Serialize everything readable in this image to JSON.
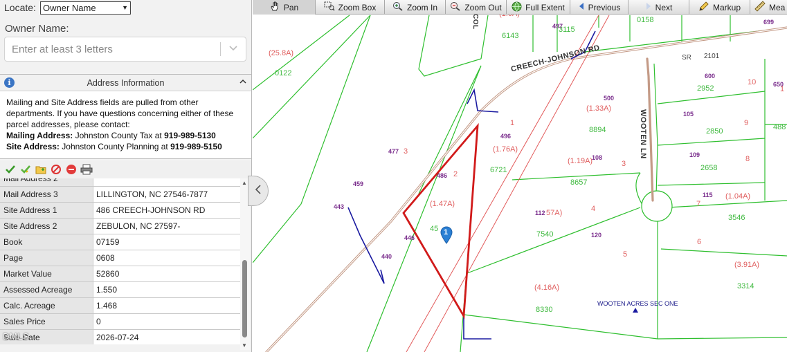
{
  "locate": {
    "label": "Locate:",
    "selected": "Owner Name"
  },
  "owner": {
    "label": "Owner Name:",
    "placeholder": "Enter at least 3 letters"
  },
  "address_panel": {
    "title": "Address Information",
    "body": "Mailing and Site Address fields are pulled from other departments. If you have questions concerning either of these parcel addresses, please contact:",
    "mailing_label": "Mailing Address:",
    "mailing_text": "Johnston County Tax at",
    "mailing_phone": "919-989-5130",
    "site_label": "Site Address:",
    "site_text": "Johnston County Planning at",
    "site_phone": "919-989-5150"
  },
  "tools": [
    "check-icon",
    "check-all-icon",
    "folder-icon",
    "cancel-icon",
    "remove-icon",
    "print-icon"
  ],
  "attributes": [
    {
      "key": "Mail Address 2",
      "value": ""
    },
    {
      "key": "Mail Address 3",
      "value": "LILLINGTON, NC 27546-7877"
    },
    {
      "key": "Site Address 1",
      "value": "486 CREECH-JOHNSON RD"
    },
    {
      "key": "Site Address 2",
      "value": "ZEBULON, NC 27597-"
    },
    {
      "key": "Book",
      "value": "07159"
    },
    {
      "key": "Page",
      "value": "0608"
    },
    {
      "key": "Market Value",
      "value": "52860"
    },
    {
      "key": "Assessed Acreage",
      "value": "1.550"
    },
    {
      "key": "Calc. Acreage",
      "value": "1.468"
    },
    {
      "key": "Sales Price",
      "value": "0"
    },
    {
      "key": "Sale Date",
      "value": "2026-07-24"
    }
  ],
  "watermark": "DMLS",
  "toolbar": [
    {
      "id": "pan",
      "label": "Pan",
      "icon": "hand-icon",
      "active": true
    },
    {
      "id": "zoom-box",
      "label": "Zoom Box",
      "icon": "zoom-box-icon"
    },
    {
      "id": "zoom-in",
      "label": "Zoom In",
      "icon": "zoom-in-icon"
    },
    {
      "id": "zoom-out",
      "label": "Zoom Out",
      "icon": "zoom-out-icon"
    },
    {
      "id": "full-extent",
      "label": "Full Extent",
      "icon": "globe-icon"
    },
    {
      "id": "previous",
      "label": "Previous",
      "icon": "arrow-left-icon"
    },
    {
      "id": "next",
      "label": "Next",
      "icon": "arrow-right-icon"
    },
    {
      "id": "markup",
      "label": "Markup",
      "icon": "pencil-icon"
    },
    {
      "id": "measure",
      "label": "Mea",
      "icon": "ruler-icon"
    }
  ],
  "map": {
    "roads": [
      "CREECH-JOHNSON RD",
      "WOOTEN LN",
      "COL",
      "SR",
      "2101"
    ],
    "subdivision": "WOOTEN ACRES SEC ONE",
    "marker": "1",
    "acreage": [
      "(25.8A)",
      "(1.33A)",
      "(1.76A)",
      "(1.19A)",
      "(1.47A)",
      "(1.04A)",
      "57A)",
      "(3.91A)",
      "(4.16A)",
      "(1.0A)"
    ],
    "parcel_ids": [
      "0122",
      "6143",
      "0158",
      "2952",
      "8894",
      "2850",
      "6721",
      "8657",
      "2658",
      "3546",
      "7540",
      "3314",
      "8330",
      "45",
      "488",
      "3115"
    ],
    "house_numbers": [
      "497",
      "699",
      "600",
      "500",
      "650",
      "105",
      "496",
      "477",
      "486",
      "108",
      "109",
      "459",
      "115",
      "443",
      "112",
      "120",
      "446",
      "440"
    ],
    "lot_numbers": [
      "1",
      "2",
      "3",
      "3",
      "4",
      "5",
      "6",
      "7",
      "8",
      "9",
      "10",
      "1"
    ]
  },
  "colors": {
    "parcel": "#2fbf2f",
    "road": "#c49a86",
    "highlight": "#d11a1a",
    "marker": "#2a7fd4",
    "easement": "#1a1aa0"
  }
}
